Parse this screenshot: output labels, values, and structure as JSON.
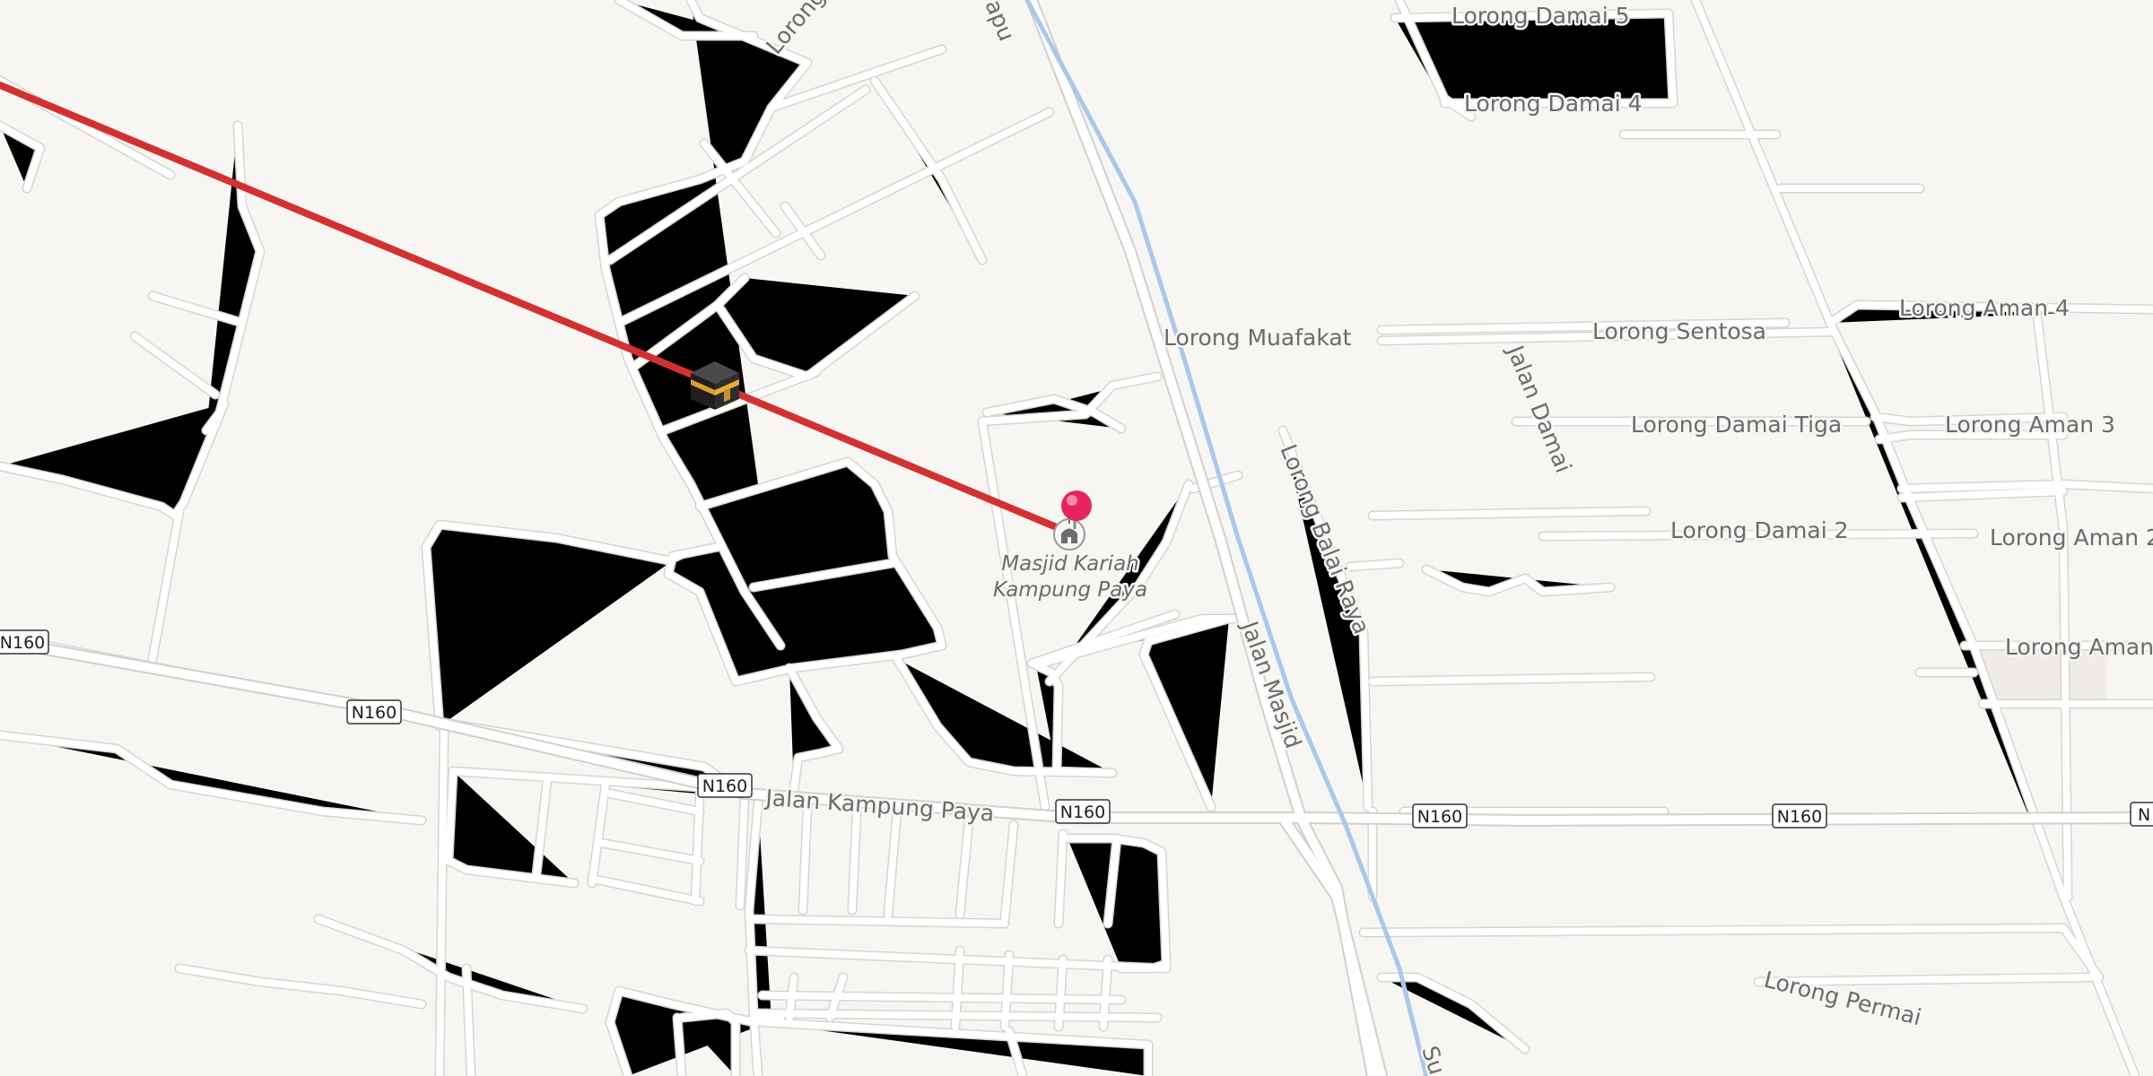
{
  "map": {
    "colors": {
      "background": "#f8f6f3",
      "road": "#ffffff",
      "road_casing": "#d8d5d0",
      "canal": "#a9c8ec",
      "qibla_line": "#d33131",
      "pin": "#e8245f"
    },
    "streets": {
      "lorong_damai_5": "Lorong Damai 5",
      "lorong_damai_4": "Lorong Damai 4",
      "lorong_muafakat": "Lorong Muafakat",
      "lorong_sentosa": "Lorong Sentosa",
      "lorong_aman_4": "Lorong Aman 4",
      "jalan_damai": "Jalan Damai",
      "lorong_damai_tiga": "Lorong Damai Tiga",
      "lorong_aman_3": "Lorong Aman 3",
      "lorong_balai_raya": "Lorong Balai Raya",
      "lorong_damai_2": "Lorong Damai 2",
      "lorong_aman_2": "Lorong Aman 2",
      "lorong_aman": "Lorong Aman",
      "jalan_masjid": "Jalan Masjid",
      "jalan_kampung_paya": "Jalan Kampung Paya",
      "lorong_permai": "Lorong Permai",
      "partial_top_left": "Lorong P",
      "partial_top_mid": "apu",
      "partial_canal": "Su"
    },
    "route_shield": "N160",
    "route_shield_partial": "N",
    "poi": {
      "name_line1": "Masjid Kariah",
      "name_line2": "Kampung Paya",
      "icon": "mosque-icon"
    },
    "markers": {
      "pin_icon": "map-pin-icon",
      "kaaba_icon": "kaaba-icon"
    }
  }
}
